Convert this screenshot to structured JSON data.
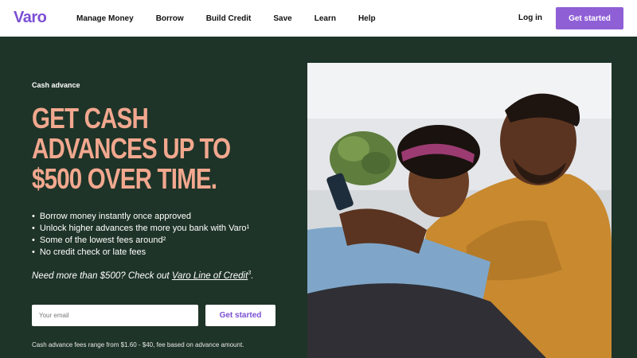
{
  "header": {
    "logo": "Varo",
    "nav": [
      "Manage Money",
      "Borrow",
      "Build Credit",
      "Save",
      "Learn",
      "Help"
    ],
    "login": "Log in",
    "cta": "Get started"
  },
  "hero": {
    "eyebrow": "Cash advance",
    "headline": "GET CASH ADVANCES UP TO $500 OVER TIME.",
    "bullets": [
      "Borrow money instantly once approved",
      "Unlock higher advances the more you bank with Varo¹",
      "Some of the lowest fees around²",
      "No credit check or late fees"
    ],
    "more_text": "Need more than $500? Check out ",
    "more_link": "Varo Line of Credit",
    "more_sup": "3",
    "more_end": ".",
    "email_placeholder": "Your email",
    "form_cta": "Get started",
    "footnote": "Cash advance fees range from $1.60 - $40, fee based on advance amount."
  },
  "colors": {
    "brand_purple": "#8f5fd6",
    "hero_bg": "#1f3428",
    "headline": "#f2a88f"
  }
}
